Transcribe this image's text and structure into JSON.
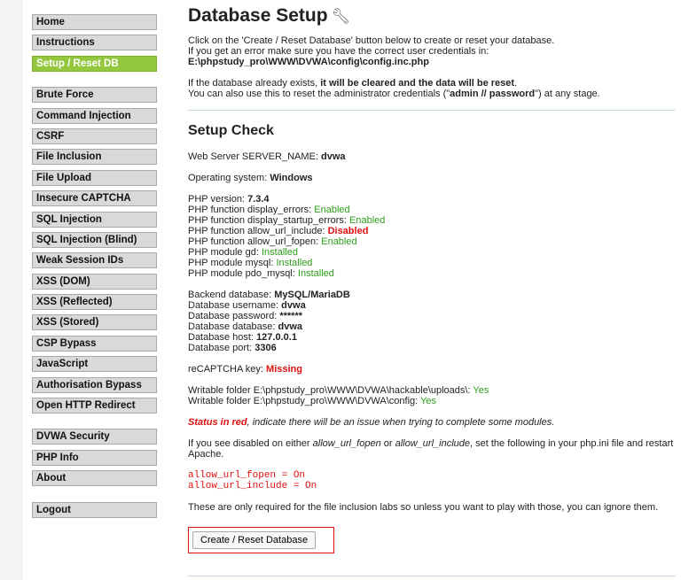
{
  "menu": {
    "group1": [
      "Home",
      "Instructions",
      "Setup / Reset DB"
    ],
    "group2": [
      "Brute Force",
      "Command Injection",
      "CSRF",
      "File Inclusion",
      "File Upload",
      "Insecure CAPTCHA",
      "SQL Injection",
      "SQL Injection (Blind)",
      "Weak Session IDs",
      "XSS (DOM)",
      "XSS (Reflected)",
      "XSS (Stored)",
      "CSP Bypass",
      "JavaScript",
      "Authorisation Bypass",
      "Open HTTP Redirect"
    ],
    "group3": [
      "DVWA Security",
      "PHP Info",
      "About"
    ],
    "group4": [
      "Logout"
    ]
  },
  "header": {
    "title": "Database Setup",
    "icon": "wrench-icon"
  },
  "intro": {
    "line1": "Click on the 'Create / Reset Database' button below to create or reset your database.",
    "line2_prefix": "If you get an error make sure you have the correct user credentials in: ",
    "config_path": "E:\\phpstudy_pro\\WWW\\DVWA\\config\\config.inc.php",
    "line3_prefix": "If the database already exists, ",
    "line3_bold": "it will be cleared and the data will be reset",
    "line3_suffix": ".",
    "line4_prefix": "You can also use this to reset the administrator credentials (\"",
    "line4_cred": "admin // password",
    "line4_suffix": "\") at any stage."
  },
  "setup_check": {
    "title": "Setup Check",
    "server_name_label": "Web Server SERVER_NAME: ",
    "server_name": "dvwa",
    "os_label": "Operating system: ",
    "os": "Windows",
    "php_version_label": "PHP version: ",
    "php_version": "7.3.4",
    "php_checks": [
      {
        "label": "PHP function display_errors: ",
        "value": "Enabled",
        "status": "green"
      },
      {
        "label": "PHP function display_startup_errors: ",
        "value": "Enabled",
        "status": "green"
      },
      {
        "label": "PHP function allow_url_include: ",
        "value": "Disabled",
        "status": "red"
      },
      {
        "label": "PHP function allow_url_fopen: ",
        "value": "Enabled",
        "status": "green"
      },
      {
        "label": "PHP module gd: ",
        "value": "Installed",
        "status": "green"
      },
      {
        "label": "PHP module mysql: ",
        "value": "Installed",
        "status": "green"
      },
      {
        "label": "PHP module pdo_mysql: ",
        "value": "Installed",
        "status": "green"
      }
    ],
    "db": [
      {
        "label": "Backend database: ",
        "value": "MySQL/MariaDB"
      },
      {
        "label": "Database username: ",
        "value": "dvwa"
      },
      {
        "label": "Database password: ",
        "value": "******"
      },
      {
        "label": "Database database: ",
        "value": "dvwa"
      },
      {
        "label": "Database host: ",
        "value": "127.0.0.1"
      },
      {
        "label": "Database port: ",
        "value": "3306"
      }
    ],
    "recaptcha_label": "reCAPTCHA key: ",
    "recaptcha_value": "Missing",
    "writable": [
      {
        "label": "Writable folder E:\\phpstudy_pro\\WWW\\DVWA\\hackable\\uploads\\: ",
        "value": "Yes"
      },
      {
        "label": "Writable folder E:\\phpstudy_pro\\WWW\\DVWA\\config: ",
        "value": "Yes"
      }
    ],
    "status_red_label": "Status in red",
    "status_red_text": ", indicate there will be an issue when trying to complete some modules.",
    "disabled_prefix": "If you see disabled on either ",
    "disabled_fopen": "allow_url_fopen",
    "disabled_or": " or ",
    "disabled_include": "allow_url_include",
    "disabled_suffix": ", set the following in your php.ini file and restart Apache.",
    "code_line1": "allow_url_fopen = On",
    "code_line2": "allow_url_include = On",
    "only_required": "These are only required for the file inclusion labs so unless you want to play with those, you can ignore them."
  },
  "button": {
    "label": "Create / Reset Database"
  },
  "colors": {
    "accent": "#93c83e",
    "error": "#dd1111",
    "ok": "#2e9c1c"
  }
}
